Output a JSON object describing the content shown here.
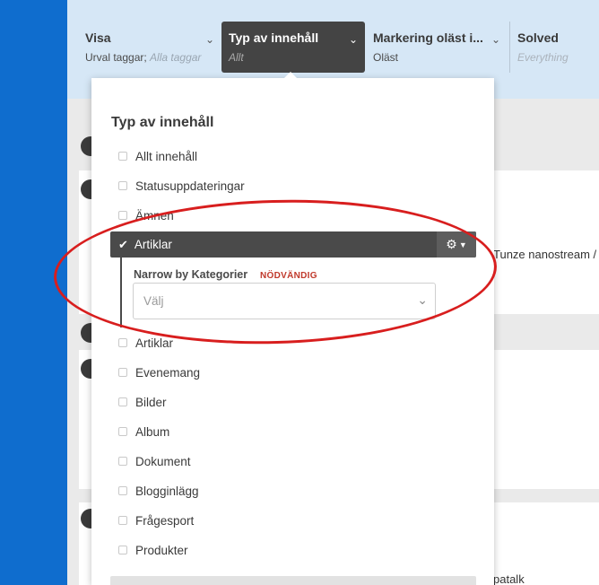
{
  "filters": {
    "visa": {
      "title": "Visa",
      "value": "Urval taggar;",
      "value_muted": "Alla taggar"
    },
    "typ": {
      "title": "Typ av innehåll",
      "value_muted": "Allt"
    },
    "markering": {
      "title": "Markering oläst i...",
      "value": "Oläst"
    },
    "solved": {
      "title": "Solved",
      "value_muted": "Everything"
    }
  },
  "dropdown": {
    "heading": "Typ av innehåll",
    "options_top": [
      "Allt innehåll",
      "Statusuppdateringar",
      "Ämnen"
    ],
    "selected": {
      "label": "Artiklar"
    },
    "narrow": {
      "label": "Narrow by Kategorier",
      "required": "NÖDVÄNDIG",
      "placeholder": "Välj"
    },
    "options_bottom": [
      "Artiklar",
      "Evenemang",
      "Bilder",
      "Album",
      "Dokument",
      "Blogginlägg",
      "Frågesport",
      "Produkter"
    ]
  },
  "background": {
    "text1": "Tunze nanostream /",
    "text2": "patalk"
  },
  "icons": {
    "chevron": "chevron-down-icon",
    "check": "check-icon",
    "gear": "gear-icon"
  },
  "colors": {
    "annotation": "#d81e1e",
    "filter_active": "#444444",
    "required": "#c0392b"
  }
}
